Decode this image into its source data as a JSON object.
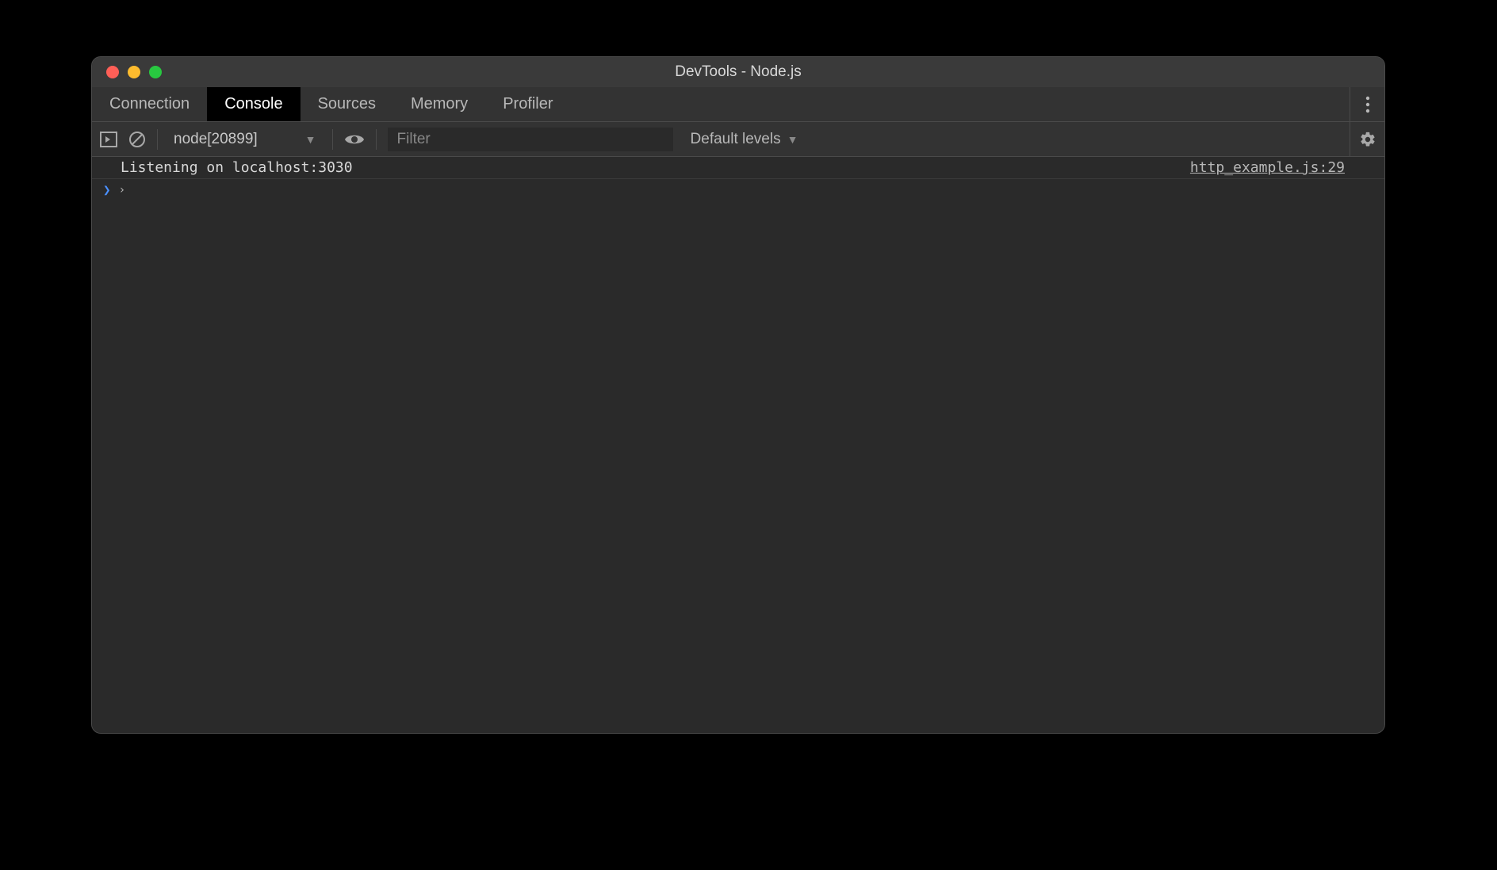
{
  "window": {
    "title": "DevTools - Node.js"
  },
  "tabs": [
    {
      "label": "Connection",
      "active": false
    },
    {
      "label": "Console",
      "active": true
    },
    {
      "label": "Sources",
      "active": false
    },
    {
      "label": "Memory",
      "active": false
    },
    {
      "label": "Profiler",
      "active": false
    }
  ],
  "toolbar": {
    "context": "node[20899]",
    "filter_placeholder": "Filter",
    "levels_label": "Default levels"
  },
  "console": {
    "logs": [
      {
        "message": "Listening on localhost:3030",
        "source": "http_example.js:29"
      }
    ]
  }
}
